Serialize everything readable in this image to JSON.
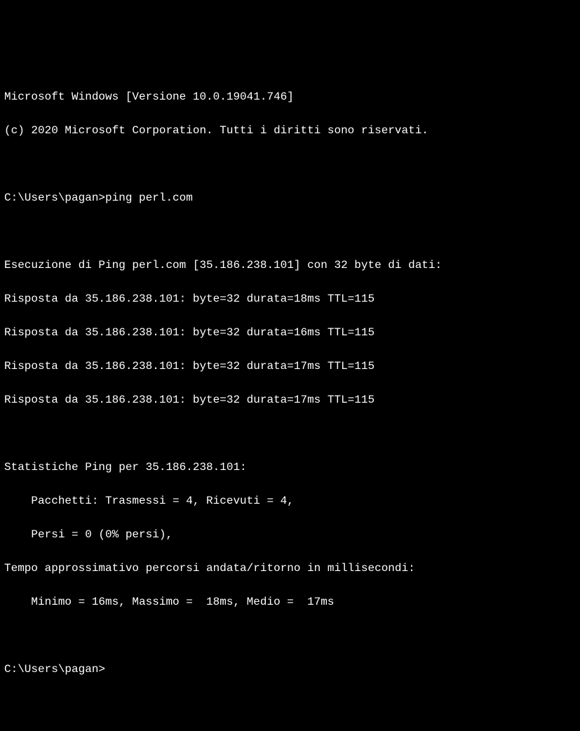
{
  "header": {
    "version_line": "Microsoft Windows [Versione 10.0.19041.746]",
    "copyright_line": "(c) 2020 Microsoft Corporation. Tutti i diritti sono riservati."
  },
  "prompt1": {
    "path": "C:\\Users\\pagan>",
    "command": "ping perl.com"
  },
  "ping": {
    "exec_line": "Esecuzione di Ping perl.com [35.186.238.101] con 32 byte di dati:",
    "replies": [
      "Risposta da 35.186.238.101: byte=32 durata=18ms TTL=115",
      "Risposta da 35.186.238.101: byte=32 durata=16ms TTL=115",
      "Risposta da 35.186.238.101: byte=32 durata=17ms TTL=115",
      "Risposta da 35.186.238.101: byte=32 durata=17ms TTL=115"
    ]
  },
  "stats": {
    "header": "Statistiche Ping per 35.186.238.101:",
    "packets": "Pacchetti: Trasmessi = 4, Ricevuti = 4,",
    "lost": "Persi = 0 (0% persi),",
    "rtt_header": "Tempo approssimativo percorsi andata/ritorno in millisecondi:",
    "rtt_values": "Minimo = 16ms, Massimo =  18ms, Medio =  17ms"
  },
  "prompt2": {
    "path": "C:\\Users\\pagan>"
  }
}
